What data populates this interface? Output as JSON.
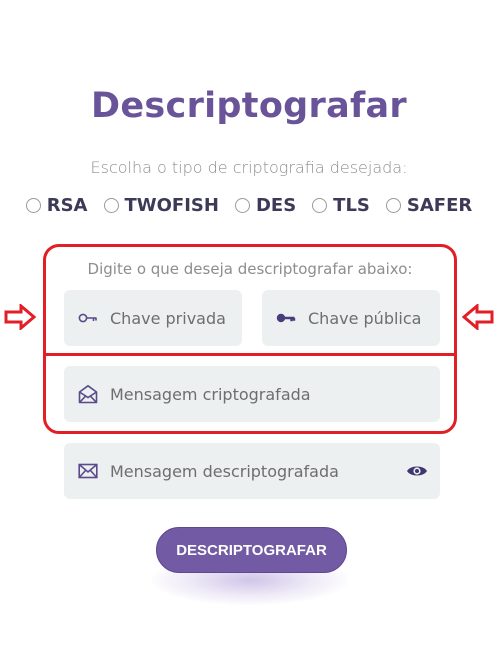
{
  "page": {
    "title": "Descriptografar"
  },
  "crypto_choice": {
    "prompt": "Escolha o tipo de criptografia desejada:",
    "options": [
      {
        "label": "RSA",
        "selected": false
      },
      {
        "label": "TWOFISH",
        "selected": false
      },
      {
        "label": "DES",
        "selected": false
      },
      {
        "label": "TLS",
        "selected": false
      },
      {
        "label": "SAFER",
        "selected": false
      }
    ]
  },
  "form": {
    "hint": "Digite o que deseja descriptografar abaixo:",
    "private_key": {
      "placeholder": "Chave privada",
      "icon": "key-outline-icon"
    },
    "public_key": {
      "placeholder": "Chave pública",
      "icon": "key-solid-icon"
    },
    "encrypted_message": {
      "placeholder": "Mensagem criptografada",
      "icon": "envelope-open-icon"
    },
    "decrypted_message": {
      "placeholder": "Mensagem descriptografada",
      "icon": "envelope-icon",
      "action_icon": "eye-icon"
    },
    "submit_label": "DESCRIPTOGRAFAR"
  },
  "colors": {
    "accent": "#725aa4",
    "title": "#6a5499",
    "highlight": "#e21f26",
    "field_bg": "#edf0f0"
  }
}
